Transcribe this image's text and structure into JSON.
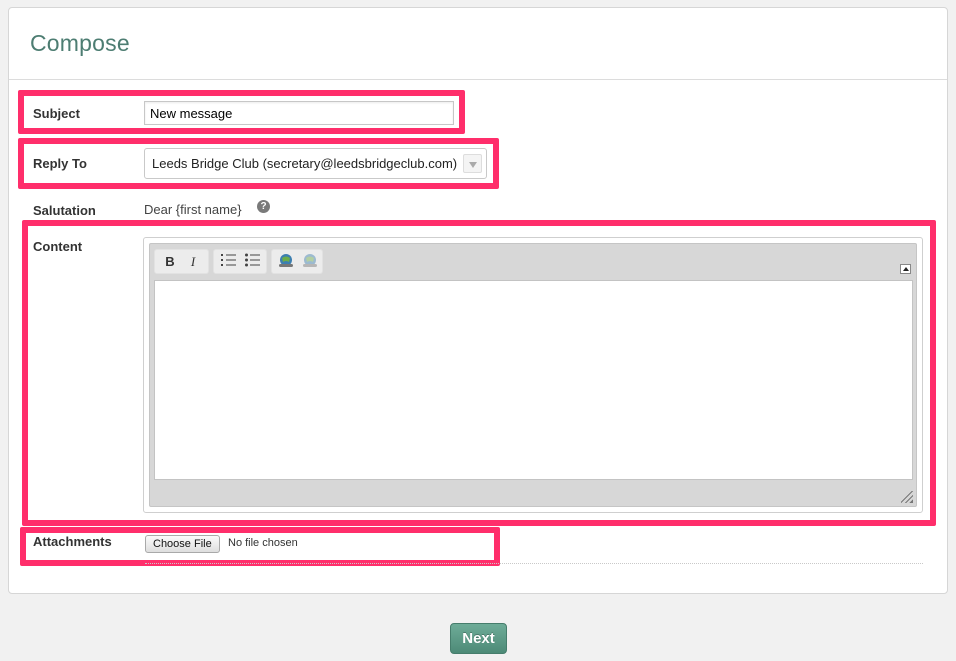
{
  "header": {
    "title": "Compose"
  },
  "form": {
    "subject": {
      "label": "Subject",
      "value": "New message"
    },
    "reply_to": {
      "label": "Reply To",
      "selected": "Leeds Bridge Club (secretary@leedsbridgeclub.com)"
    },
    "salutation": {
      "label": "Salutation",
      "value": "Dear {first name}",
      "help": "?"
    },
    "content": {
      "label": "Content",
      "toolbar": {
        "bold": "B",
        "italic": "I"
      }
    },
    "attachments": {
      "label": "Attachments",
      "button": "Choose File",
      "status": "No file chosen"
    }
  },
  "actions": {
    "next": "Next"
  },
  "colors": {
    "highlight": "#ff2e6b",
    "accent": "#4d7d72",
    "button": "#5a9885"
  }
}
